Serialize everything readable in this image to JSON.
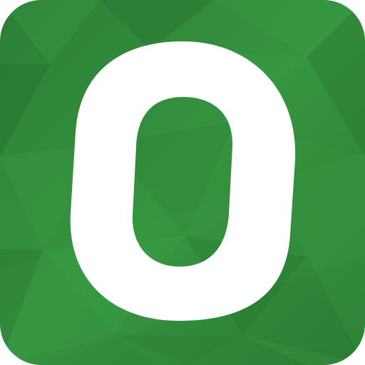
{
  "icon": {
    "name": "O",
    "background_color": "#2f8a3c",
    "glyph_color": "#ffffff"
  }
}
